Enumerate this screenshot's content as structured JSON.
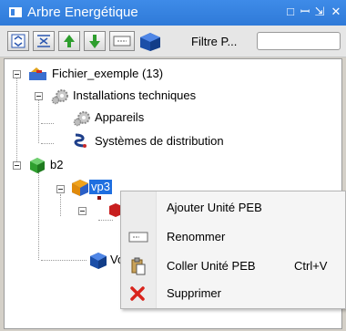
{
  "window": {
    "title": "Arbre Energétique",
    "title_buttons": [
      "□",
      "ꟷ",
      "⇲",
      "✕"
    ]
  },
  "toolbar": {
    "filter_label": "Filtre P...",
    "filter_value": ""
  },
  "tree": {
    "root": "Fichier_exemple (13)",
    "installations": "Installations techniques",
    "appareils": "Appareils",
    "systemes": "Systèmes de distribution",
    "b2": "b2",
    "vp3": "vp3",
    "vo_partial": "Vo"
  },
  "context_menu": {
    "items": [
      {
        "label": "Ajouter Unité PEB",
        "shortcut": ""
      },
      {
        "label": "Renommer",
        "shortcut": ""
      },
      {
        "label": "Coller Unité PEB",
        "shortcut": "Ctrl+V"
      },
      {
        "label": "Supprimer",
        "shortcut": ""
      }
    ]
  },
  "colors": {
    "title_bar": "#2f7ad8",
    "selection": "#1f6fe0",
    "delete_red": "#d9241c",
    "toolbar_green": "#2e9e2e"
  }
}
